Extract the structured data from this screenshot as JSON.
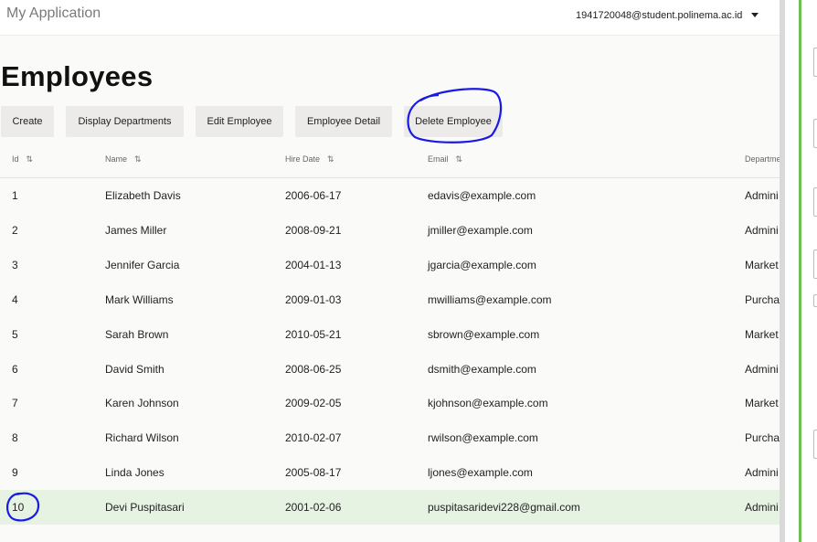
{
  "app": {
    "title": "My Application",
    "user_email": "1941720048@student.polinema.ac.id"
  },
  "page": {
    "title": "Employees"
  },
  "toolbar": {
    "create": "Create",
    "display_departments": "Display Departments",
    "edit_employee": "Edit Employee",
    "employee_detail": "Employee Detail",
    "delete_employee": "Delete Employee"
  },
  "table": {
    "columns": [
      "Id",
      "Name",
      "Hire Date",
      "Email",
      "Departme"
    ],
    "rows": [
      {
        "id": "1",
        "name": "Elizabeth Davis",
        "hire_date": "2006-06-17",
        "email": "edavis@example.com",
        "dept": "Admini"
      },
      {
        "id": "2",
        "name": "James Miller",
        "hire_date": "2008-09-21",
        "email": "jmiller@example.com",
        "dept": "Admini"
      },
      {
        "id": "3",
        "name": "Jennifer Garcia",
        "hire_date": "2004-01-13",
        "email": "jgarcia@example.com",
        "dept": "Market"
      },
      {
        "id": "4",
        "name": "Mark Williams",
        "hire_date": "2009-01-03",
        "email": "mwilliams@example.com",
        "dept": "Purcha"
      },
      {
        "id": "5",
        "name": "Sarah Brown",
        "hire_date": "2010-05-21",
        "email": "sbrown@example.com",
        "dept": "Market"
      },
      {
        "id": "6",
        "name": "David Smith",
        "hire_date": "2008-06-25",
        "email": "dsmith@example.com",
        "dept": "Admini"
      },
      {
        "id": "7",
        "name": "Karen Johnson",
        "hire_date": "2009-02-05",
        "email": "kjohnson@example.com",
        "dept": "Market"
      },
      {
        "id": "8",
        "name": "Richard Wilson",
        "hire_date": "2010-02-07",
        "email": "rwilson@example.com",
        "dept": "Purcha"
      },
      {
        "id": "9",
        "name": "Linda Jones",
        "hire_date": "2005-08-17",
        "email": "ljones@example.com",
        "dept": "Admini"
      },
      {
        "id": "10",
        "name": "Devi Puspitasari",
        "hire_date": "2001-02-06",
        "email": "puspitasaridevi228@gmail.com",
        "dept": "Admini"
      }
    ],
    "selected_row": 9
  },
  "icons": {
    "sort": "sort-arrows-icon",
    "user_menu": "chevron-down-icon"
  },
  "colors": {
    "selected_row": "#e6f3e3",
    "annotation": "#1a1ae6",
    "panel_accent": "#6fbf57"
  }
}
